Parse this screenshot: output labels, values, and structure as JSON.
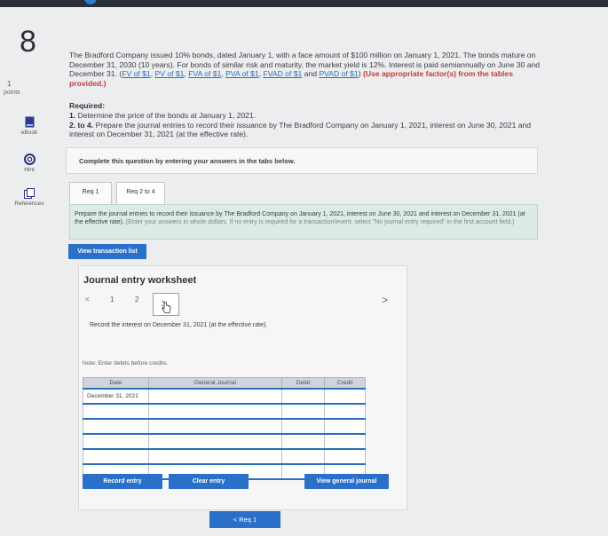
{
  "question": {
    "number": "8",
    "points_value": "1",
    "points_label": "points"
  },
  "tools": [
    {
      "label": "eBook",
      "icon": "book-icon"
    },
    {
      "label": "Hint",
      "icon": "lifebuoy-icon"
    },
    {
      "label": "References",
      "icon": "references-icon"
    }
  ],
  "problem": {
    "text_start": "The Bradford Company issued 10% bonds, dated January 1, with a face amount of $100 million on January 1, 2021. The bonds mature on December 31, 2030 (10 years). For bonds of similar risk and maturity, the market yield is 12%. Interest is paid semiannually on June 30 and December 31.",
    "links": [
      "FV of $1",
      "PV of $1",
      "FVA of $1",
      "PVA of $1",
      "FVAD of $1",
      "PVAD of $1"
    ],
    "and_word": "and",
    "instruction": "(Use appropriate factor(s) from the tables provided.)"
  },
  "required": {
    "title": "Required:",
    "item1_num": "1.",
    "item1_text": "Determine the price of the bonds at January 1, 2021.",
    "item2_num": "2. to 4.",
    "item2_text": "Prepare the journal entries to record their issuance by The Bradford Company on January 1, 2021, interest on June 30, 2021 and interest on December 31, 2021 (at the effective rate)."
  },
  "instruction_box": "Complete this question by entering your answers in the tabs below.",
  "tabs": [
    {
      "label": "Req 1"
    },
    {
      "label": "Req 2 to 4"
    }
  ],
  "tab_instruction": {
    "main": "Prepare the journal entries to record their issuance by The Bradford Company on January 1, 2021, interest on June 30, 2021 and interest on December 31, 2021 (at the effective rate).",
    "faint": "(Enter your answers in whole dollars. If no entry is required for a transaction/event, select \"No journal entry required\" in the first account field.)"
  },
  "view_transaction_label": "View transaction list",
  "worksheet": {
    "title": "Journal entry worksheet",
    "prev_arrow": "<",
    "next_arrow": ">",
    "pages": [
      "1",
      "2",
      "3"
    ],
    "description": "Record the interest on December 31, 2021 (at the effective rate).",
    "note": "Note: Enter debits before credits.",
    "columns": [
      "Date",
      "General Journal",
      "Debit",
      "Credit"
    ],
    "rows": [
      [
        "December 31, 2021",
        "",
        "",
        ""
      ],
      [
        "",
        "",
        "",
        ""
      ],
      [
        "",
        "",
        "",
        ""
      ],
      [
        "",
        "",
        "",
        ""
      ],
      [
        "",
        "",
        "",
        ""
      ],
      [
        "",
        "",
        "",
        ""
      ]
    ],
    "buttons": {
      "record": "Record entry",
      "clear": "Clear entry",
      "view_journal": "View general journal"
    }
  },
  "nav": {
    "prev_label": "< Req 1"
  },
  "colors": {
    "accent": "#2a70c8",
    "link": "#2a6fbe",
    "red": "#c63a3a",
    "green_box": "#dcebe6"
  }
}
